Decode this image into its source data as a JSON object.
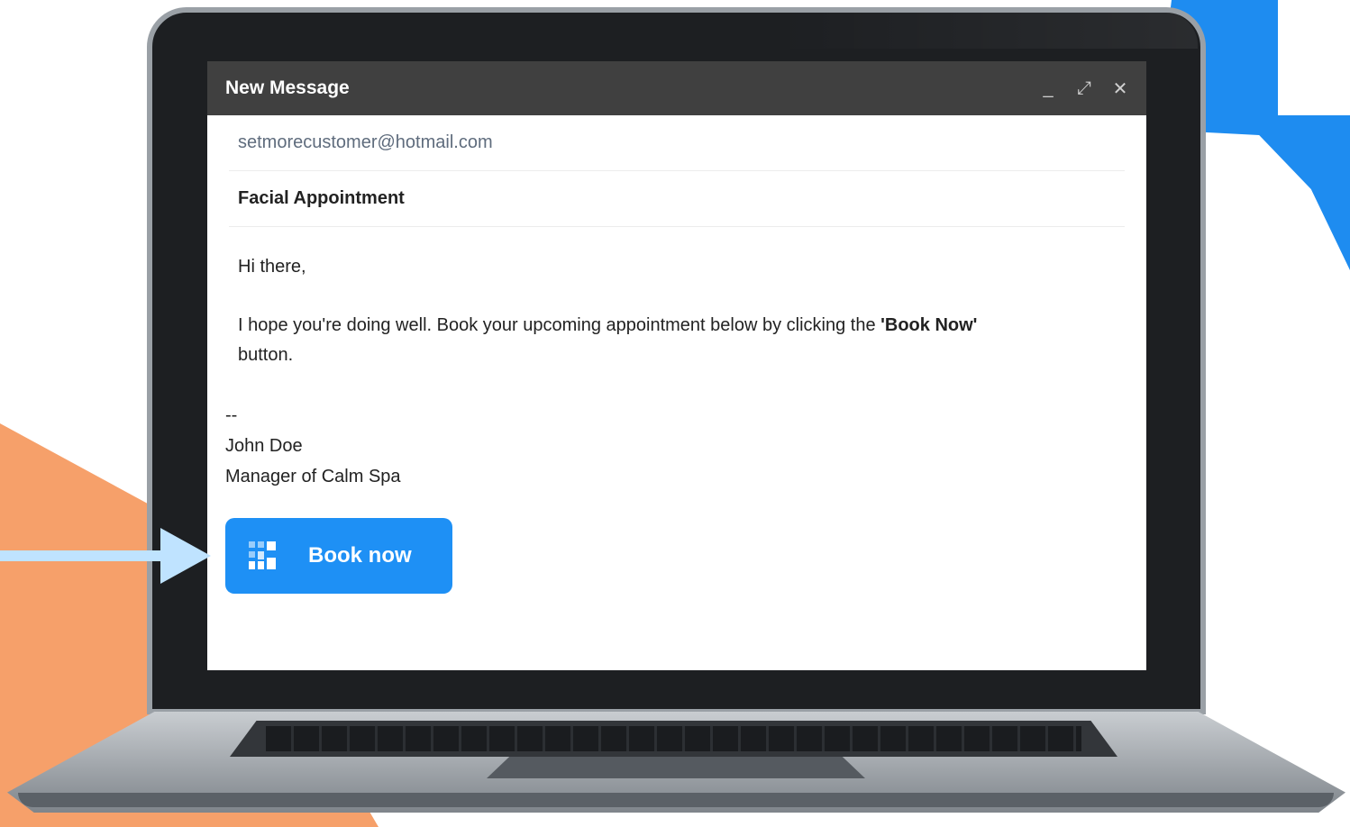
{
  "email": {
    "window_title": "New Message",
    "controls": {
      "minimize": "_",
      "expand": "⤢",
      "close": "✕"
    },
    "to": "setmorecustomer@hotmail.com",
    "subject": "Facial Appointment",
    "body": {
      "greeting": "Hi there,",
      "para_before": "I hope you're doing well. Book your upcoming appointment below by clicking the ",
      "para_bold": "'Book Now'",
      "para_after": " button."
    },
    "signature": {
      "separator": "--",
      "name": "John Doe",
      "title": "Manager of Calm Spa"
    },
    "button": {
      "label": "Book now",
      "icon": "setmore-logo-icon"
    }
  },
  "colors": {
    "button": "#1E90F5",
    "titlebar": "#404040",
    "accent_blue": "#1E8CF0",
    "accent_orange": "#F6A06A",
    "arrow": "#BFE3FF"
  }
}
